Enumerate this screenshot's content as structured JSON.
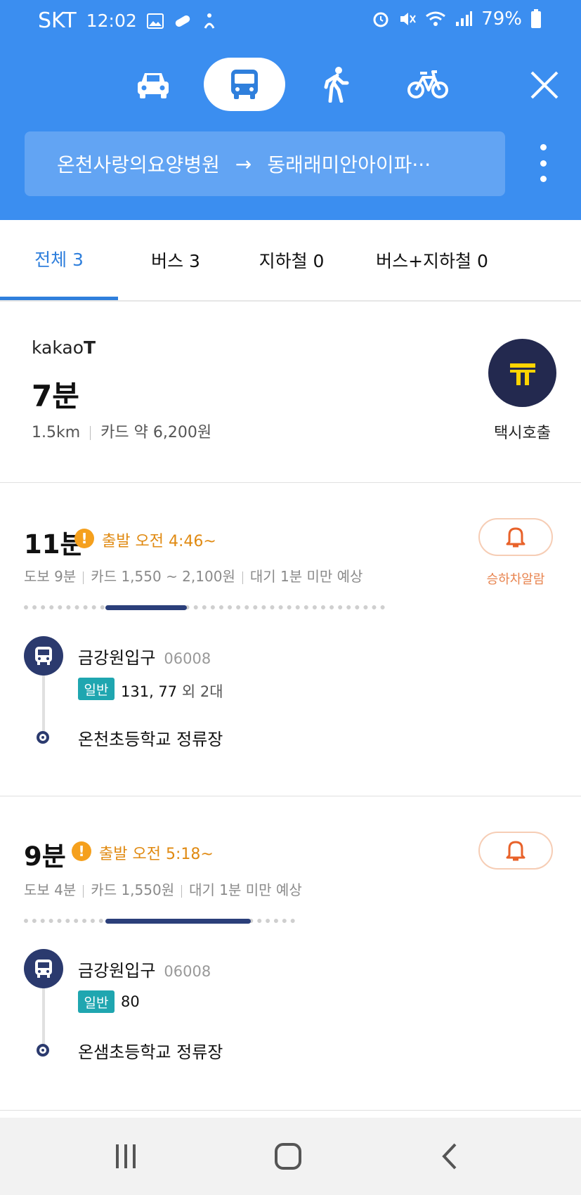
{
  "status_bar": {
    "carrier": "SKT",
    "time": "12:02",
    "battery": "79%",
    "icons": [
      "gallery-icon",
      "pill-icon",
      "accessibility-icon",
      "alarm-icon",
      "mute-icon",
      "wifi-icon",
      "signal-icon",
      "battery-icon"
    ]
  },
  "header": {
    "modes": [
      "car-icon",
      "bus-icon",
      "walk-icon",
      "bike-icon"
    ],
    "selected_mode": "bus",
    "origin": "온천사랑의요양병원",
    "arrow": "→",
    "destination": "동래래미안아이파···",
    "accent": "#3b8ef0"
  },
  "tabs": [
    {
      "label": "전체 3",
      "active": true
    },
    {
      "label": "버스 3",
      "active": false
    },
    {
      "label": "지하철 0",
      "active": false
    },
    {
      "label": "버스+지하철 0",
      "active": false
    }
  ],
  "taxi": {
    "brand_prefix": "kakao",
    "brand_suffix": "T",
    "time": "7분",
    "distance": "1.5km",
    "fare": "카드 약 6,200원",
    "button_label": "택시호출"
  },
  "routes": [
    {
      "time": "11분",
      "depart": "출발 오전 4:46~",
      "walk": "도보 9분",
      "fare": "카드 1,550 ~ 2,100원",
      "wait": "대기 1분 미만 예상",
      "alarm_label": "승하차알람",
      "board_stop": "금강원입구",
      "stop_id": "06008",
      "bus_type": "일반",
      "bus_numbers": "131, 77",
      "bus_extra": "외 2대",
      "alight_stop": "온천초등학교 정류장"
    },
    {
      "time": "9분",
      "depart": "출발 오전 5:18~",
      "walk": "도보 4분",
      "fare": "카드 1,550원",
      "wait": "대기 1분 미만 예상",
      "board_stop": "금강원입구",
      "stop_id": "06008",
      "bus_type": "일반",
      "bus_numbers": "80",
      "alight_stop": "온샘초등학교 정류장"
    }
  ],
  "nav_bar": [
    "recent-apps-icon",
    "home-icon",
    "back-icon"
  ]
}
